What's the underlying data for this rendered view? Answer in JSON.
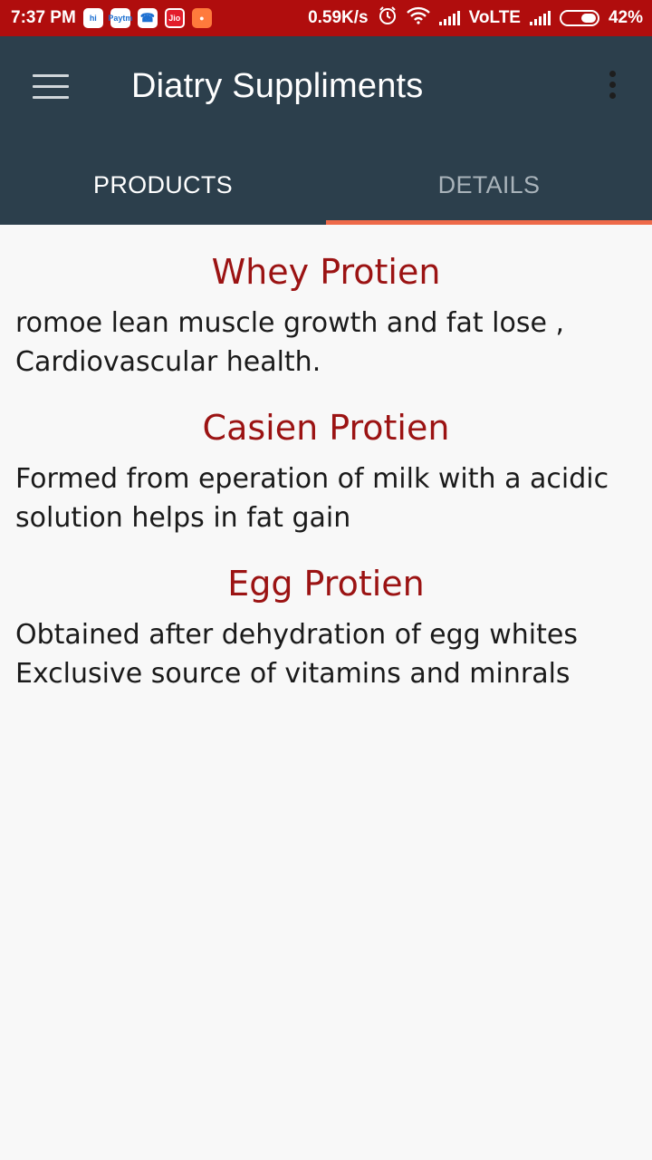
{
  "status_bar": {
    "time": "7:37 PM",
    "speed": "0.59K/s",
    "network": "VoLTE",
    "battery": "42%",
    "app_icons": [
      "hi",
      "paytm",
      "phone",
      "jio",
      "pig"
    ]
  },
  "app_bar": {
    "title": "Diatry Suppliments",
    "menu_icon": "hamburger-menu-icon",
    "more_icon": "more-vertical-icon",
    "background": "#2c3f4c"
  },
  "tabs": [
    {
      "label": "PRODUCTS",
      "selected": false
    },
    {
      "label": "DETAILS",
      "selected": true
    }
  ],
  "accent": "#ee6a4a",
  "title_color": "#9b1313",
  "sections": [
    {
      "title": "Whey Protien",
      "description": "romoe lean muscle growth and fat lose , Cardiovascular health."
    },
    {
      "title": "Casien Protien",
      "description": "Formed from eperation of milk with a acidic solution helps in fat gain"
    },
    {
      "title": "Egg Protien",
      "description": "Obtained after dehydration of egg whites Exclusive source of vitamins and minrals"
    }
  ]
}
